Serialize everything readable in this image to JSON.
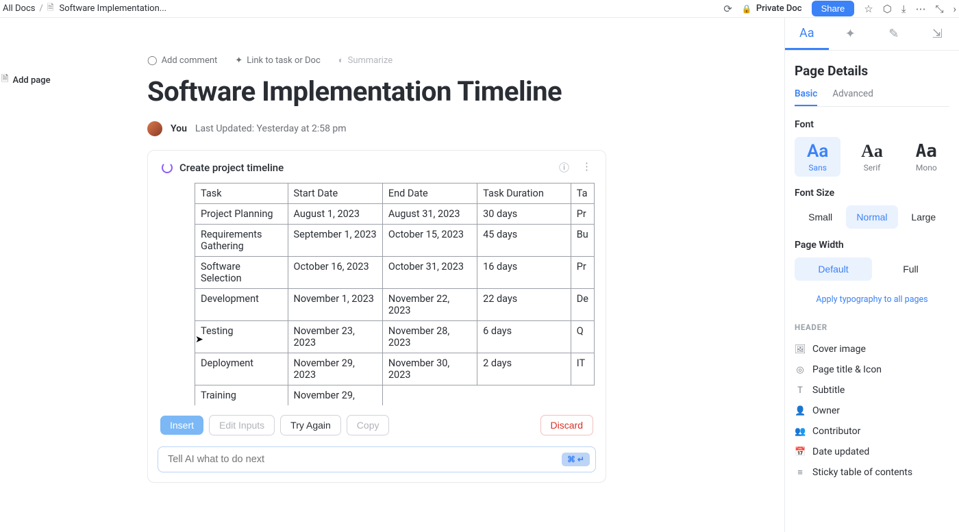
{
  "breadcrumb": {
    "root": "All Docs",
    "doc": "Software Implementation..."
  },
  "topbar": {
    "private": "Private Doc",
    "share": "Share"
  },
  "sidebar": {
    "add_page": "Add page"
  },
  "actions": {
    "comment": "Add comment",
    "link": "Link to task or Doc",
    "summarize": "Summarize"
  },
  "doc": {
    "title": "Software Implementation Timeline",
    "author": "You",
    "updated": "Last Updated:  Yesterday at 2:58 pm"
  },
  "ai": {
    "prompt_title": "Create project timeline",
    "insert": "Insert",
    "edit": "Edit Inputs",
    "retry": "Try Again",
    "copy": "Copy",
    "discard": "Discard",
    "placeholder": "Tell AI what to do next",
    "shortcut": "⌘ ↵"
  },
  "table": {
    "headers": [
      "Task",
      "Start Date",
      "End Date",
      "Task Duration",
      "Ta"
    ],
    "rows": [
      [
        "Project Planning",
        "August 1, 2023",
        "August 31, 2023",
        "30 days",
        "Pr"
      ],
      [
        "Requirements Gathering",
        "September 1, 2023",
        "October 15, 2023",
        "45 days",
        "Bu"
      ],
      [
        "Software Selection",
        "October 16, 2023",
        "October 31, 2023",
        "16 days",
        "Pr"
      ],
      [
        "Development",
        "November 1, 2023",
        "November 22, 2023",
        "22 days",
        "De"
      ],
      [
        "Testing",
        "November 23, 2023",
        "November 28, 2023",
        "6 days",
        "Q"
      ],
      [
        "Deployment",
        "November 29, 2023",
        "November 30, 2023",
        "2 days",
        "IT"
      ],
      [
        "Training",
        "November 29,",
        "",
        "",
        ""
      ]
    ]
  },
  "panel": {
    "title": "Page Details",
    "tabs": {
      "basic": "Basic",
      "advanced": "Advanced"
    },
    "font_label": "Font",
    "fonts": {
      "sans": "Sans",
      "serif": "Serif",
      "mono": "Mono"
    },
    "fontsize_label": "Font Size",
    "sizes": {
      "small": "Small",
      "normal": "Normal",
      "large": "Large"
    },
    "width_label": "Page Width",
    "widths": {
      "default": "Default",
      "full": "Full"
    },
    "apply": "Apply typography to all pages",
    "header_section": "HEADER",
    "header_items": {
      "cover": "Cover image",
      "title": "Page title & Icon",
      "subtitle": "Subtitle",
      "owner": "Owner",
      "contributor": "Contributor",
      "date": "Date updated",
      "toc": "Sticky table of contents"
    }
  }
}
